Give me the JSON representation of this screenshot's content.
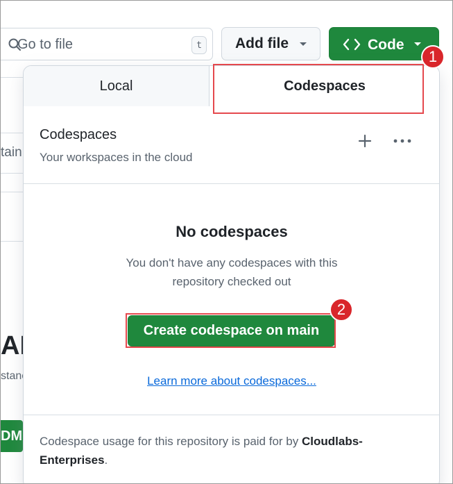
{
  "search": {
    "placeholder": "Go to file",
    "shortcut": "t"
  },
  "toolbar": {
    "add_file_label": "Add file",
    "code_label": "Code"
  },
  "background": {
    "partial_text_1": "tain",
    "partial_heading": "AD",
    "partial_text_2": "stanc",
    "partial_button": "DM"
  },
  "annotations": {
    "step1": "1",
    "step2": "2"
  },
  "panel": {
    "tabs": [
      {
        "label": "Local",
        "selected": false
      },
      {
        "label": "Codespaces",
        "selected": true
      }
    ],
    "header": {
      "title": "Codespaces",
      "subtitle": "Your workspaces in the cloud"
    },
    "empty_state": {
      "title": "No codespaces",
      "description": "You don't have any codespaces with this repository checked out",
      "create_button": "Create codespace on main",
      "learn_link": "Learn more about codespaces..."
    },
    "footer": {
      "text_prefix": "Codespace usage for this repository is paid for by",
      "org_name": "Cloudlabs-Enterprises",
      "text_suffix": "."
    }
  },
  "colors": {
    "primary_green": "#1f883d",
    "annotation_red": "#d9262b",
    "link_blue": "#0969da"
  }
}
